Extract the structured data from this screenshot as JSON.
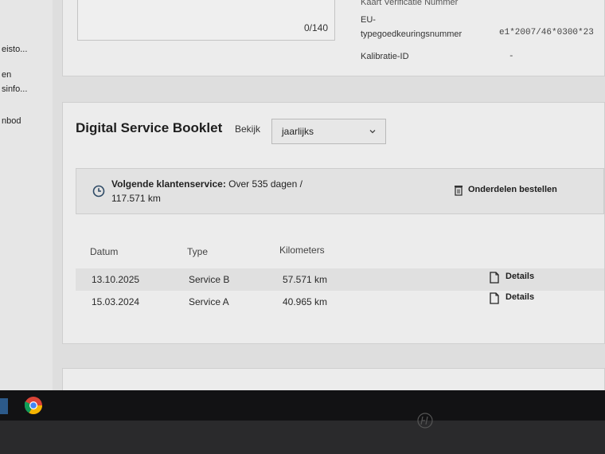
{
  "sidebar": {
    "items": [
      "eisto...",
      "en",
      "sinfo...",
      "nbod"
    ]
  },
  "top_panel": {
    "counter": "0/140",
    "labels": {
      "card_number": "Kaart Verificatie Nummer",
      "eu_type_prefix": "EU-",
      "eu_type": "typegoedkeuringsnummer",
      "calibration": "Kalibratie-ID"
    },
    "values": {
      "eu_type_value": "e1*2007/46*0300*23",
      "calibration_value": "-"
    }
  },
  "booklet": {
    "title": "Digital Service Booklet",
    "view_label": "Bekijk",
    "view_select": "jaarlijks",
    "next_service_label": "Volgende klantenservice:",
    "next_service_value_line1": " Over 535 dagen /",
    "next_service_value_line2": "117.571 km",
    "order_button": "Onderdelen bestellen",
    "columns": [
      "Datum",
      "Type",
      "Kilometers"
    ],
    "rows": [
      {
        "date": "13.10.2025",
        "type": "Service B",
        "km": "57.571 km",
        "details": "Details"
      },
      {
        "date": "15.03.2024",
        "type": "Service A",
        "km": "40.965 km",
        "details": "Details"
      }
    ]
  },
  "colors": {
    "accent": "#2a2a2a",
    "chrome_red": "#db4437",
    "chrome_yellow": "#f4b400",
    "chrome_green": "#0f9d58",
    "chrome_blue": "#4285f4"
  },
  "icons": [
    "clock-icon",
    "trash-icon",
    "document-icon",
    "chevron-down-icon",
    "chrome-icon",
    "windows-icon",
    "hp-logo"
  ]
}
